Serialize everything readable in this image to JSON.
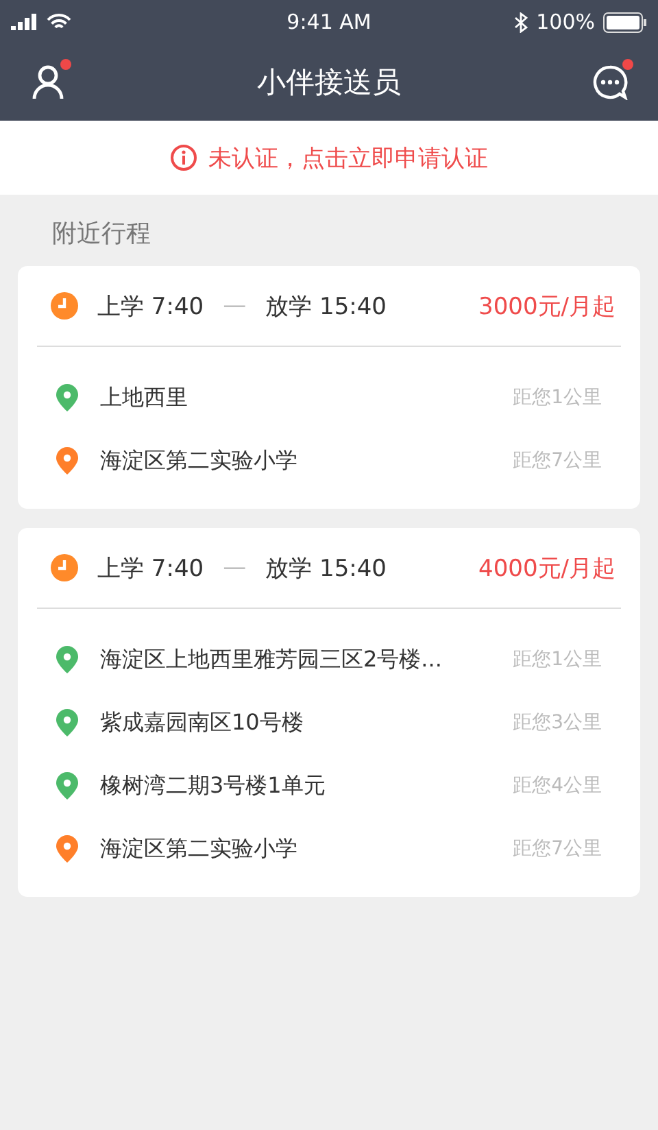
{
  "status_bar": {
    "time": "9:41 AM",
    "battery": "100%"
  },
  "header": {
    "title": "小伴接送员",
    "profile_badge": true,
    "message_badge": true
  },
  "notice": {
    "text": "未认证，点击立即申请认证"
  },
  "section_title": "附近行程",
  "trips": [
    {
      "start": "上学 7:40",
      "dash": "—",
      "end": "放学 15:40",
      "price": "3000元/月起",
      "stops": [
        {
          "name": "上地西里",
          "distance": "距您1公里",
          "color": "#4cba6a"
        },
        {
          "name": "海淀区第二实验小学",
          "distance": "距您7公里",
          "color": "#ff7f2a"
        }
      ]
    },
    {
      "start": "上学 7:40",
      "dash": "—",
      "end": "放学 15:40",
      "price": "4000元/月起",
      "stops": [
        {
          "name": "海淀区上地西里雅芳园三区2号楼...",
          "distance": "距您1公里",
          "color": "#4cba6a"
        },
        {
          "name": "紫成嘉园南区10号楼",
          "distance": "距您3公里",
          "color": "#4cba6a"
        },
        {
          "name": "橡树湾二期3号楼1单元",
          "distance": "距您4公里",
          "color": "#4cba6a"
        },
        {
          "name": "海淀区第二实验小学",
          "distance": "距您7公里",
          "color": "#ff7f2a"
        }
      ]
    }
  ]
}
